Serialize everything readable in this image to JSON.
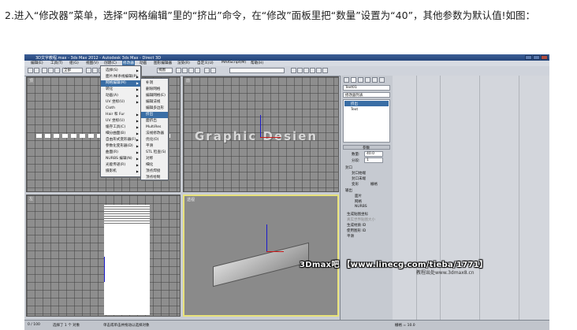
{
  "caption": "2.进入“修改器”菜单，选择“网格编辑”里的“挤出”命令，在“修改”面板里把“数量”设置为“40”，其他参数为默认值!如图：",
  "window": {
    "title": "3D文字教程.max - 3ds Max 2012 - Autodesk 3ds Max - Direct 3D"
  },
  "menubar": [
    "编辑(E)",
    "工具(T)",
    "组(G)",
    "视图(V)",
    "创建(C)",
    "修改器",
    "动画",
    "图形编辑器",
    "渲染(R)",
    "自定义(U)",
    "MAXScript(M)",
    "帮助(H)"
  ],
  "toolbar": {
    "select_filter": "全部",
    "view_dropdown": "视图"
  },
  "viewport_text": "Graphic Desien",
  "viewport_labels": {
    "top": "顶",
    "front": "前",
    "left": "左",
    "perspective": "透视"
  },
  "modifiers_menu": {
    "items": [
      {
        "label": "选择(S)",
        "arrow": true
      },
      {
        "label": "面片/样条线编辑(P)",
        "arrow": true
      },
      {
        "label": "网格编辑(M)",
        "arrow": true,
        "highlighted": true
      },
      {
        "label": "转化",
        "arrow": true
      },
      {
        "label": "动画(A)",
        "arrow": true
      },
      {
        "label": "UV 坐标(U)",
        "arrow": true
      },
      {
        "label": "Cloth",
        "arrow": false
      },
      {
        "label": "Hair 和 Fur",
        "arrow": true
      },
      {
        "label": "UV 坐标(U)",
        "arrow": true
      },
      {
        "label": "缓存工具(C)",
        "arrow": true
      },
      {
        "label": "细分曲面(B)",
        "arrow": true
      },
      {
        "label": "自由形式变形器(F)",
        "arrow": true
      },
      {
        "label": "参数化变形器(D)",
        "arrow": true
      },
      {
        "label": "曲面(R)",
        "arrow": true
      },
      {
        "label": "NURBS 编辑(N)",
        "arrow": true
      },
      {
        "label": "光能传递(R)",
        "arrow": true
      },
      {
        "label": "摄影机",
        "arrow": true
      }
    ]
  },
  "mesh_submenu": {
    "items": [
      {
        "label": "补洞"
      },
      {
        "label": "删除网格"
      },
      {
        "label": "编辑网格(E)"
      },
      {
        "label": "编辑法线"
      },
      {
        "label": "编辑多边形"
      },
      {
        "label": "挤出",
        "highlighted": true
      },
      {
        "label": "面挤出"
      },
      {
        "label": "MultiRes"
      },
      {
        "label": "法线修改器"
      },
      {
        "label": "优化(O)"
      },
      {
        "label": "平滑"
      },
      {
        "label": "STL 检查(S)"
      },
      {
        "label": "对称"
      },
      {
        "label": "细化"
      },
      {
        "label": "顶点焊接"
      },
      {
        "label": "顶点绘制"
      }
    ]
  },
  "command_panel": {
    "object_name": "Text01",
    "modifier_list_label": "修改器列表",
    "stack": [
      "挤出",
      "Text"
    ],
    "rollout_title": "参数",
    "amount_label": "数量:",
    "amount_value": "40.0",
    "segments_label": "分段:",
    "segments_value": "1",
    "capping_title": "封口",
    "cap_start": "封口始端",
    "cap_end": "封口末端",
    "morph": "变形",
    "grid": "栅格",
    "output_title": "输出",
    "output_patch": "面片",
    "output_mesh": "网格",
    "output_nurbs": "NURBS",
    "gen_mapping": "生成贴图坐标",
    "real_world": "真实世界贴图大小",
    "gen_mat_ids": "生成材质 ID",
    "use_shape_ids": "使用图形 ID",
    "smooth": "平滑"
  },
  "statusbar": {
    "frame_slider": "0 / 100",
    "selected": "选择了 1 个 对象",
    "hint": "单击或单击并拖动以选择对象",
    "grid": "栅格 = 10.0"
  },
  "watermark": {
    "main": "3Dmax吧 【www.linecg.com/tieba/1771】",
    "sub": "教程出处www.3dmax8.cn"
  }
}
